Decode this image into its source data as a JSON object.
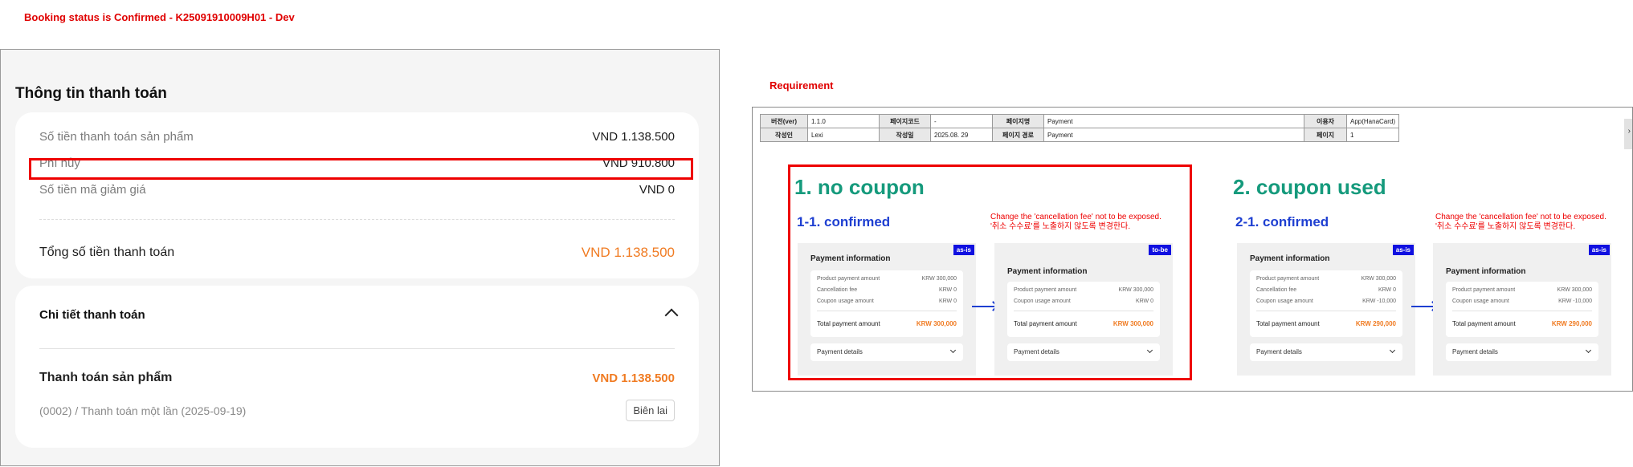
{
  "header": {
    "title": "Booking status is Confirmed - K25091910009H01 - Dev"
  },
  "payment": {
    "title": "Thông tin thanh toán",
    "rows": [
      {
        "label": "Số tiền thanh toán sản phẩm",
        "value": "VND 1.138.500"
      },
      {
        "label": "Phí hủy",
        "value": "VND 910.800"
      },
      {
        "label": "Số tiền mã giảm giá",
        "value": "VND 0"
      }
    ],
    "total": {
      "label": "Tổng số tiền thanh toán",
      "value": "VND 1.138.500"
    },
    "details": {
      "title": "Chi tiết thanh toán",
      "item_label": "Thanh toán sản phẩm",
      "item_amount": "VND 1.138.500",
      "item_sub": "(0002) / Thanh toán một lần (2025-09-19)",
      "receipt_button": "Biên lai"
    }
  },
  "requirement": {
    "label": "Requirement",
    "meta": {
      "version_h": "버전(ver)",
      "version": "1.1.0",
      "pagecode_h": "페이지코드",
      "pagecode": "-",
      "pagename_h": "페이지명",
      "pagename": "Payment",
      "user_h": "이용자",
      "user": "App(HanaCard)",
      "author_h": "작성인",
      "author": "Lexi",
      "date_h": "작성일",
      "date": "2025.08. 29",
      "path_h": "페이지 경로",
      "path": "Payment",
      "page_h": "페이지",
      "page": "1"
    },
    "sec1": {
      "title": "1. no coupon",
      "sub": "1-1. confirmed"
    },
    "sec2": {
      "title": "2. coupon used",
      "sub": "2-1. confirmed"
    },
    "note_en": "Change the 'cancellation fee' not to be exposed.",
    "note_kr": "'취소 수수료'를 노출하지 않도록 변경한다.",
    "mock_common": {
      "title": "Payment information",
      "product_label": "Product payment amount",
      "cancel_label": "Cancellation fee",
      "coupon_label": "Coupon usage amount",
      "total_label": "Total payment amount",
      "details_label": "Payment details",
      "tag_asis": "as-is",
      "tag_tobe": "to-be"
    },
    "m1": {
      "product": "KRW 300,000",
      "cancel": "KRW 0",
      "coupon": "KRW 0",
      "total": "KRW 300,000"
    },
    "m2": {
      "product": "KRW 300,000",
      "coupon": "KRW 0",
      "total": "KRW 300,000"
    },
    "m3": {
      "product": "KRW 300,000",
      "cancel": "KRW 0",
      "coupon": "KRW -10,000",
      "total": "KRW 290,000"
    },
    "m4": {
      "product": "KRW 300,000",
      "coupon": "KRW -10,000",
      "total": "KRW 290,000"
    }
  }
}
